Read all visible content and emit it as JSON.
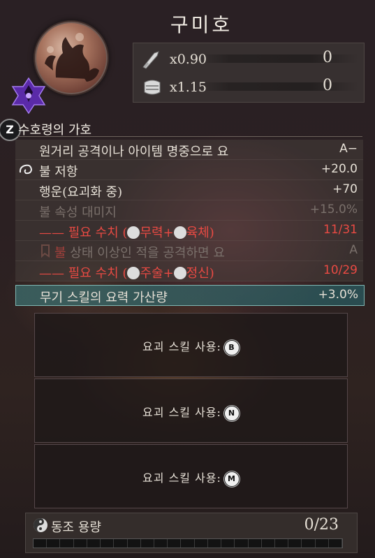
{
  "header": {
    "title": "구미호"
  },
  "stats": [
    {
      "icon": "sword-icon",
      "multiplier": "x0.90",
      "value": "0"
    },
    {
      "icon": "armor-icon",
      "multiplier": "x1.15",
      "value": "0"
    }
  ],
  "section": {
    "hotkey": "Z",
    "title": "수호령의 가호"
  },
  "bonuses": [
    {
      "text": "원거리 공격이나 아이템 명중으로 요",
      "value": "A−",
      "style": "normal"
    },
    {
      "text": "불 저항",
      "value": "+20.0",
      "style": "normal"
    },
    {
      "text": "행운(요괴화 중)",
      "value": "+70",
      "style": "normal"
    },
    {
      "text": "불 속성 대미지",
      "value": "+15.0%",
      "style": "dim"
    },
    {
      "text_prefix": "—— 필요 수치 (",
      "req1": "무력",
      "plus": "+",
      "req2": "육체",
      "text_suffix": ")",
      "value": "11/31",
      "style": "red"
    },
    {
      "text_red": "불",
      "text": " 상태 이상인 적을 공격하면 요",
      "value": "A",
      "style": "dim"
    },
    {
      "text_prefix": "—— 필요 수치 (",
      "req1": "주술",
      "plus": "+",
      "req2": "정신",
      "text_suffix": ")",
      "value": "10/29",
      "style": "red"
    },
    {
      "text": "무기 스킬의 요력 가산량",
      "value": "+3.0%",
      "style": "highlight"
    }
  ],
  "skill_slots": [
    {
      "label": "요괴 스킬 사용:",
      "key": "B"
    },
    {
      "label": "요괴 스킬 사용:",
      "key": "N"
    },
    {
      "label": "요괴 스킬 사용:",
      "key": "M"
    }
  ],
  "sync": {
    "label": "동조 용량",
    "value": "0/23",
    "fill_fraction": 0
  }
}
